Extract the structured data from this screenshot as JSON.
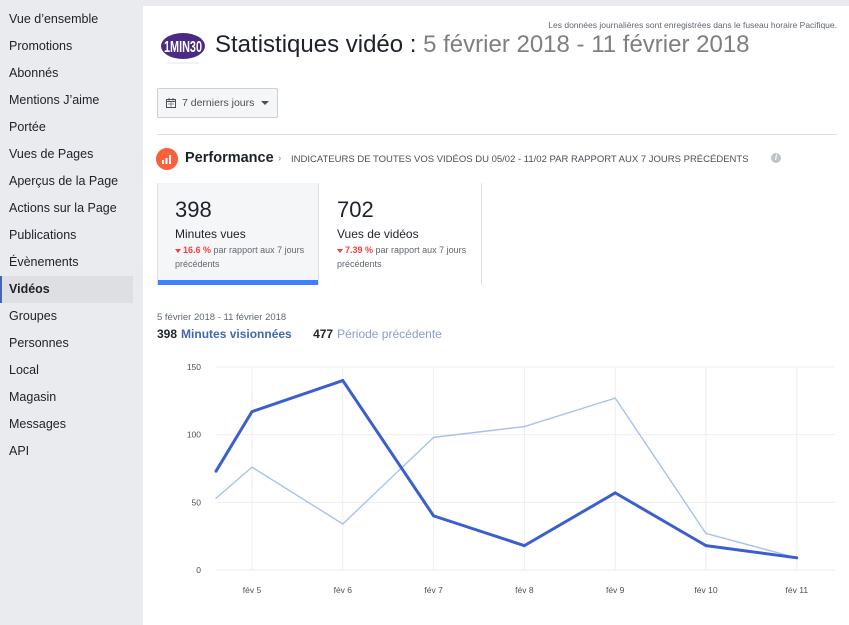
{
  "sidebar": {
    "items": [
      {
        "label": "Vue d’ensemble",
        "active": false
      },
      {
        "label": "Promotions",
        "active": false
      },
      {
        "label": "Abonnés",
        "active": false
      },
      {
        "label": "Mentions J’aime",
        "active": false
      },
      {
        "label": "Portée",
        "active": false
      },
      {
        "label": "Vues de Pages",
        "active": false
      },
      {
        "label": "Aperçus de la Page",
        "active": false
      },
      {
        "label": "Actions sur la Page",
        "active": false
      },
      {
        "label": "Publications",
        "active": false
      },
      {
        "label": "Évènements",
        "active": false
      },
      {
        "label": "Vidéos",
        "active": true
      },
      {
        "label": "Groupes",
        "active": false
      },
      {
        "label": "Personnes",
        "active": false
      },
      {
        "label": "Local",
        "active": false
      },
      {
        "label": "Magasin",
        "active": false
      },
      {
        "label": "Messages",
        "active": false
      },
      {
        "label": "API",
        "active": false
      }
    ]
  },
  "header": {
    "timezone_note": "Les données journalières sont enregistrées dans le fuseau horaire Pacifique.",
    "logo_text": "1MIN30",
    "title": "Statistiques vidéo :",
    "date_range": "5 février 2018 - 11 février 2018",
    "range_selector": "7 derniers jours"
  },
  "performance": {
    "title": "Performance",
    "chevron": "›",
    "subtitle": "INDICATEURS DE TOUTES VOS VIDÉOS DU 05/02 - 11/02 PAR RAPPORT AUX 7 JOURS PRÉCÉDENTS",
    "info": "i",
    "cards": [
      {
        "value": "398",
        "label": "Minutes vues",
        "change": "16.6 %",
        "change_suffix": "par rapport aux 7 jours précédents",
        "selected": true
      },
      {
        "value": "702",
        "label": "Vues de vidéos",
        "change": "7.39 %",
        "change_suffix": "par rapport aux 7 jours précédents",
        "selected": false
      }
    ]
  },
  "colors": {
    "accent": "#4267b2",
    "current_series": "#3b5fcc",
    "previous_series": "#a9c0ef",
    "negative": "#fa3e3e",
    "performance_icon": "#f7623c",
    "selected_bar": "#4080ff"
  },
  "chart_data": {
    "type": "line",
    "title": "5 février 2018 - 11 février 2018",
    "xlabel": "",
    "ylabel": "",
    "categories": [
      "fév 5",
      "fév 6",
      "fév 7",
      "fév 8",
      "fév 9",
      "fév 10",
      "fév 11"
    ],
    "yticks": [
      0,
      50,
      100,
      150
    ],
    "ylim": [
      0,
      150
    ],
    "grid": true,
    "legend_position": "top-left",
    "lead_in": {
      "current": 73,
      "previous": 53
    },
    "series": [
      {
        "name": "Minutes visionnées",
        "total": "398",
        "values": [
          117,
          140,
          40,
          18,
          57,
          18,
          9
        ]
      },
      {
        "name": "Période précédente",
        "total": "477",
        "values": [
          76,
          34,
          98,
          106,
          127,
          27,
          9
        ]
      }
    ]
  }
}
